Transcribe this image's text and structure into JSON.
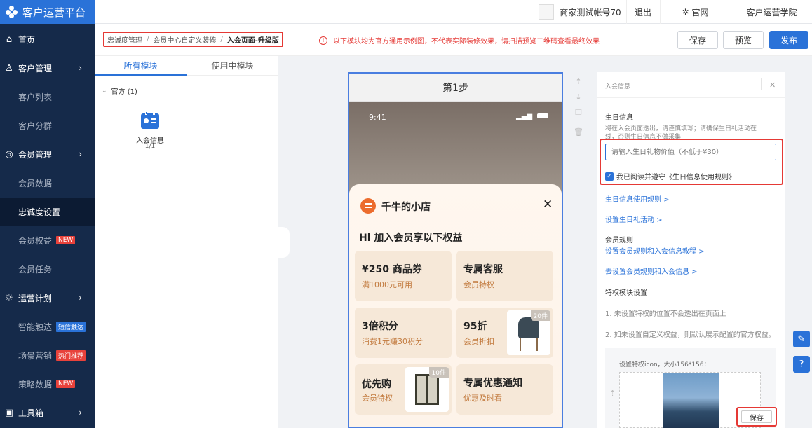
{
  "app": {
    "title": "客户运营平台"
  },
  "topbar": {
    "account": "商家测试帐号70",
    "logout": "退出",
    "official_site": "官网",
    "academy": "客户运营学院"
  },
  "sidebar": {
    "items": [
      {
        "label": "首页",
        "icon": "home-icon"
      },
      {
        "label": "客户管理",
        "icon": "customers-icon"
      },
      {
        "label": "客户列表"
      },
      {
        "label": "客户分群"
      },
      {
        "label": "会员管理",
        "icon": "member-icon"
      },
      {
        "label": "会员数据"
      },
      {
        "label": "忠诚度设置"
      },
      {
        "label": "会员权益",
        "badge": "NEW"
      },
      {
        "label": "会员任务"
      },
      {
        "label": "运营计划",
        "icon": "bulb-icon"
      },
      {
        "label": "智能触达",
        "badge": "短信触达"
      },
      {
        "label": "场景营销",
        "badge": "热门推荐"
      },
      {
        "label": "策略数据",
        "badge": "NEW"
      },
      {
        "label": "工具箱",
        "icon": "toolbox-icon"
      }
    ]
  },
  "toolbar": {
    "breadcrumb": [
      "忠诚度管理",
      "会员中心自定义装修",
      "入会页面-升级版"
    ],
    "notice": "以下模块均为官方通用示例图，不代表实际装修效果，请扫描预览二维码查看最终效果",
    "save": "保存",
    "preview": "预览",
    "publish": "发布"
  },
  "modules": {
    "tabs": [
      "所有模块",
      "使用中模块"
    ],
    "group": "官方 (1)",
    "item_name": "入会信息",
    "item_count": "1/1"
  },
  "phone": {
    "step": "第1步",
    "time": "9:41",
    "shop_name": "千牛的小店",
    "headline": "Hi 加入会员享以下权益",
    "cards": [
      {
        "title": "¥250 商品券",
        "sub": "满1000元可用"
      },
      {
        "title": "专属客服",
        "sub": "会员特权"
      },
      {
        "title": "3倍积分",
        "sub": "消费1元赚30积分"
      },
      {
        "title": "95折",
        "sub": "会员折扣",
        "tag": "20件"
      },
      {
        "title": "优先购",
        "sub": "会员特权",
        "tag": "10件"
      },
      {
        "title": "专属优惠通知",
        "sub": "优惠及时看"
      }
    ]
  },
  "settings": {
    "panel_title": "入会信息",
    "birthday_title": "生日信息",
    "birthday_desc_1": "将在入会页面透出，请谨慎填写；请确保生日礼活动在",
    "birthday_desc_2": "线，否则生日信息不做采集",
    "gift_placeholder": "请输入生日礼物价值（不低于¥30）",
    "agree_text": "我已阅读并遵守《生日信息使用规则》",
    "link_rules": "生日信息使用规则 >",
    "link_gift": "设置生日礼活动 >",
    "member_rules_title": "会员规则",
    "link_tutorial": "设置会员规则和入会信息教程 >",
    "link_goto": "去设置会员规则和入会信息 >",
    "privilege_title": "特权模块设置",
    "note_1": "1. 未设置特权的位置不会透出在页面上",
    "note_2": "2. 如未设置自定义权益，则默认展示配置的官方权益。",
    "icon_hint": "设置特权icon，大小156*156：",
    "save": "保存"
  },
  "colors": {
    "accent": "#2a72d8",
    "sidebar": "#152a4a",
    "alert": "#e53935"
  }
}
